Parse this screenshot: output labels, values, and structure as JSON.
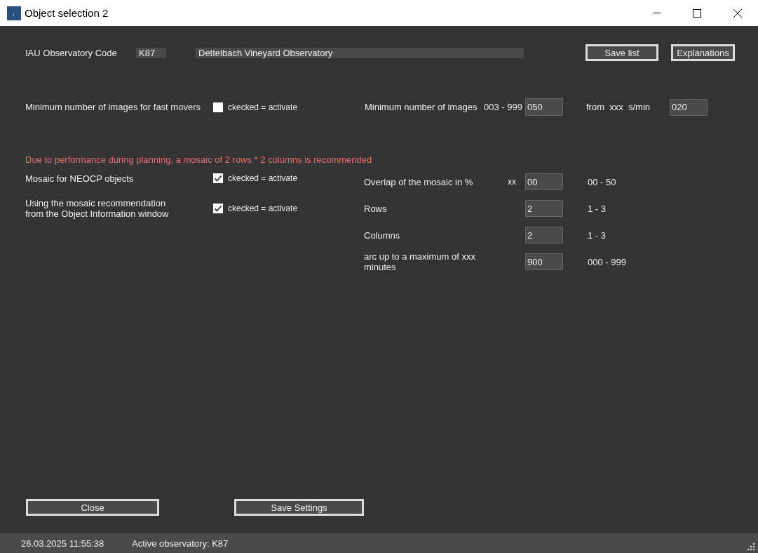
{
  "window": {
    "title": "Object selection 2"
  },
  "observatory": {
    "label": "IAU Observatory Code",
    "code": "K87",
    "name": "Dettelbach Vineyard Observatory"
  },
  "top_buttons": [
    "Save list",
    "Explanations"
  ],
  "fast_movers": {
    "label": "Minimum number of images for fast movers",
    "checked": false,
    "check_label": "ckecked = activate",
    "min_images_label": "Minimum number of images",
    "min_images_range": "003 - 999",
    "min_images": "050",
    "from_label": "from  xxx  s/min",
    "from_value": "020"
  },
  "warning": "Due to performance during planning, a mosaic of 2 rows * 2 columns is recommended",
  "mosaic_options": [
    {
      "label": "Mosaic for NEOCP objects",
      "checked": true,
      "check_label": "ckecked = activate"
    },
    {
      "label": "Using the mosaic recommendation\nfrom the Object Information window",
      "checked": true,
      "check_label": "ckecked = activate"
    }
  ],
  "mosaic_settings": [
    {
      "label": "Overlap of the mosaic in %",
      "unit": "xx",
      "value": "00",
      "range": "00 - 50"
    },
    {
      "label": "Rows",
      "value": "2",
      "range": "1 - 3"
    },
    {
      "label": "Columns",
      "value": "2",
      "range": "1 - 3"
    },
    {
      "label": "arc up to a maximum of xxx minutes",
      "value": "900",
      "range": "000 - 999"
    }
  ],
  "bottom_buttons": [
    "Close",
    "Save Settings"
  ],
  "status_bar": {
    "datetime": "26.03.2025 11:55:38",
    "observatory": "Active observatory: K87"
  }
}
